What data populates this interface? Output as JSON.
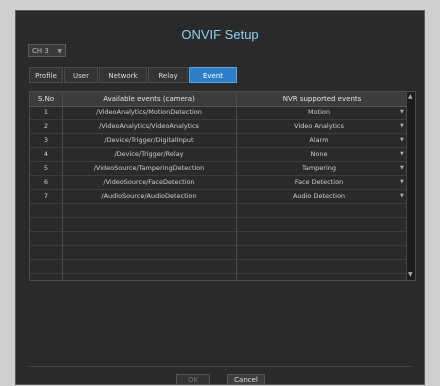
{
  "title": "ONVIF Setup",
  "channel": {
    "value": "CH 3"
  },
  "tabs": [
    "Profile",
    "User",
    "Network",
    "Relay",
    "Event"
  ],
  "active_tab": "Event",
  "table": {
    "headers": [
      "S.No",
      "Available events (camera)",
      "NVR supported events"
    ],
    "rows": [
      {
        "no": "1",
        "event": "/VideoAnalytics/MotionDetection",
        "nvr": "Motion"
      },
      {
        "no": "2",
        "event": "/VideoAnalytics/VideoAnalytics",
        "nvr": "Video Analytics"
      },
      {
        "no": "3",
        "event": "/Device/Trigger/DigitalInput",
        "nvr": "Alarm"
      },
      {
        "no": "4",
        "event": "/Device/Trigger/Relay",
        "nvr": "None"
      },
      {
        "no": "5",
        "event": "/VideoSource/TamperingDetection",
        "nvr": "Tampering"
      },
      {
        "no": "6",
        "event": "/VideoSource/FaceDetection",
        "nvr": "Face Detection"
      },
      {
        "no": "7",
        "event": "/AudioSource/AudioDetection",
        "nvr": "Audio Detection"
      }
    ]
  },
  "buttons": {
    "ok": "OK",
    "cancel": "Cancel"
  },
  "colors": {
    "title": "#8fd0f5",
    "active_tab": "#2f7fc8",
    "background": "#2a2a2a"
  }
}
